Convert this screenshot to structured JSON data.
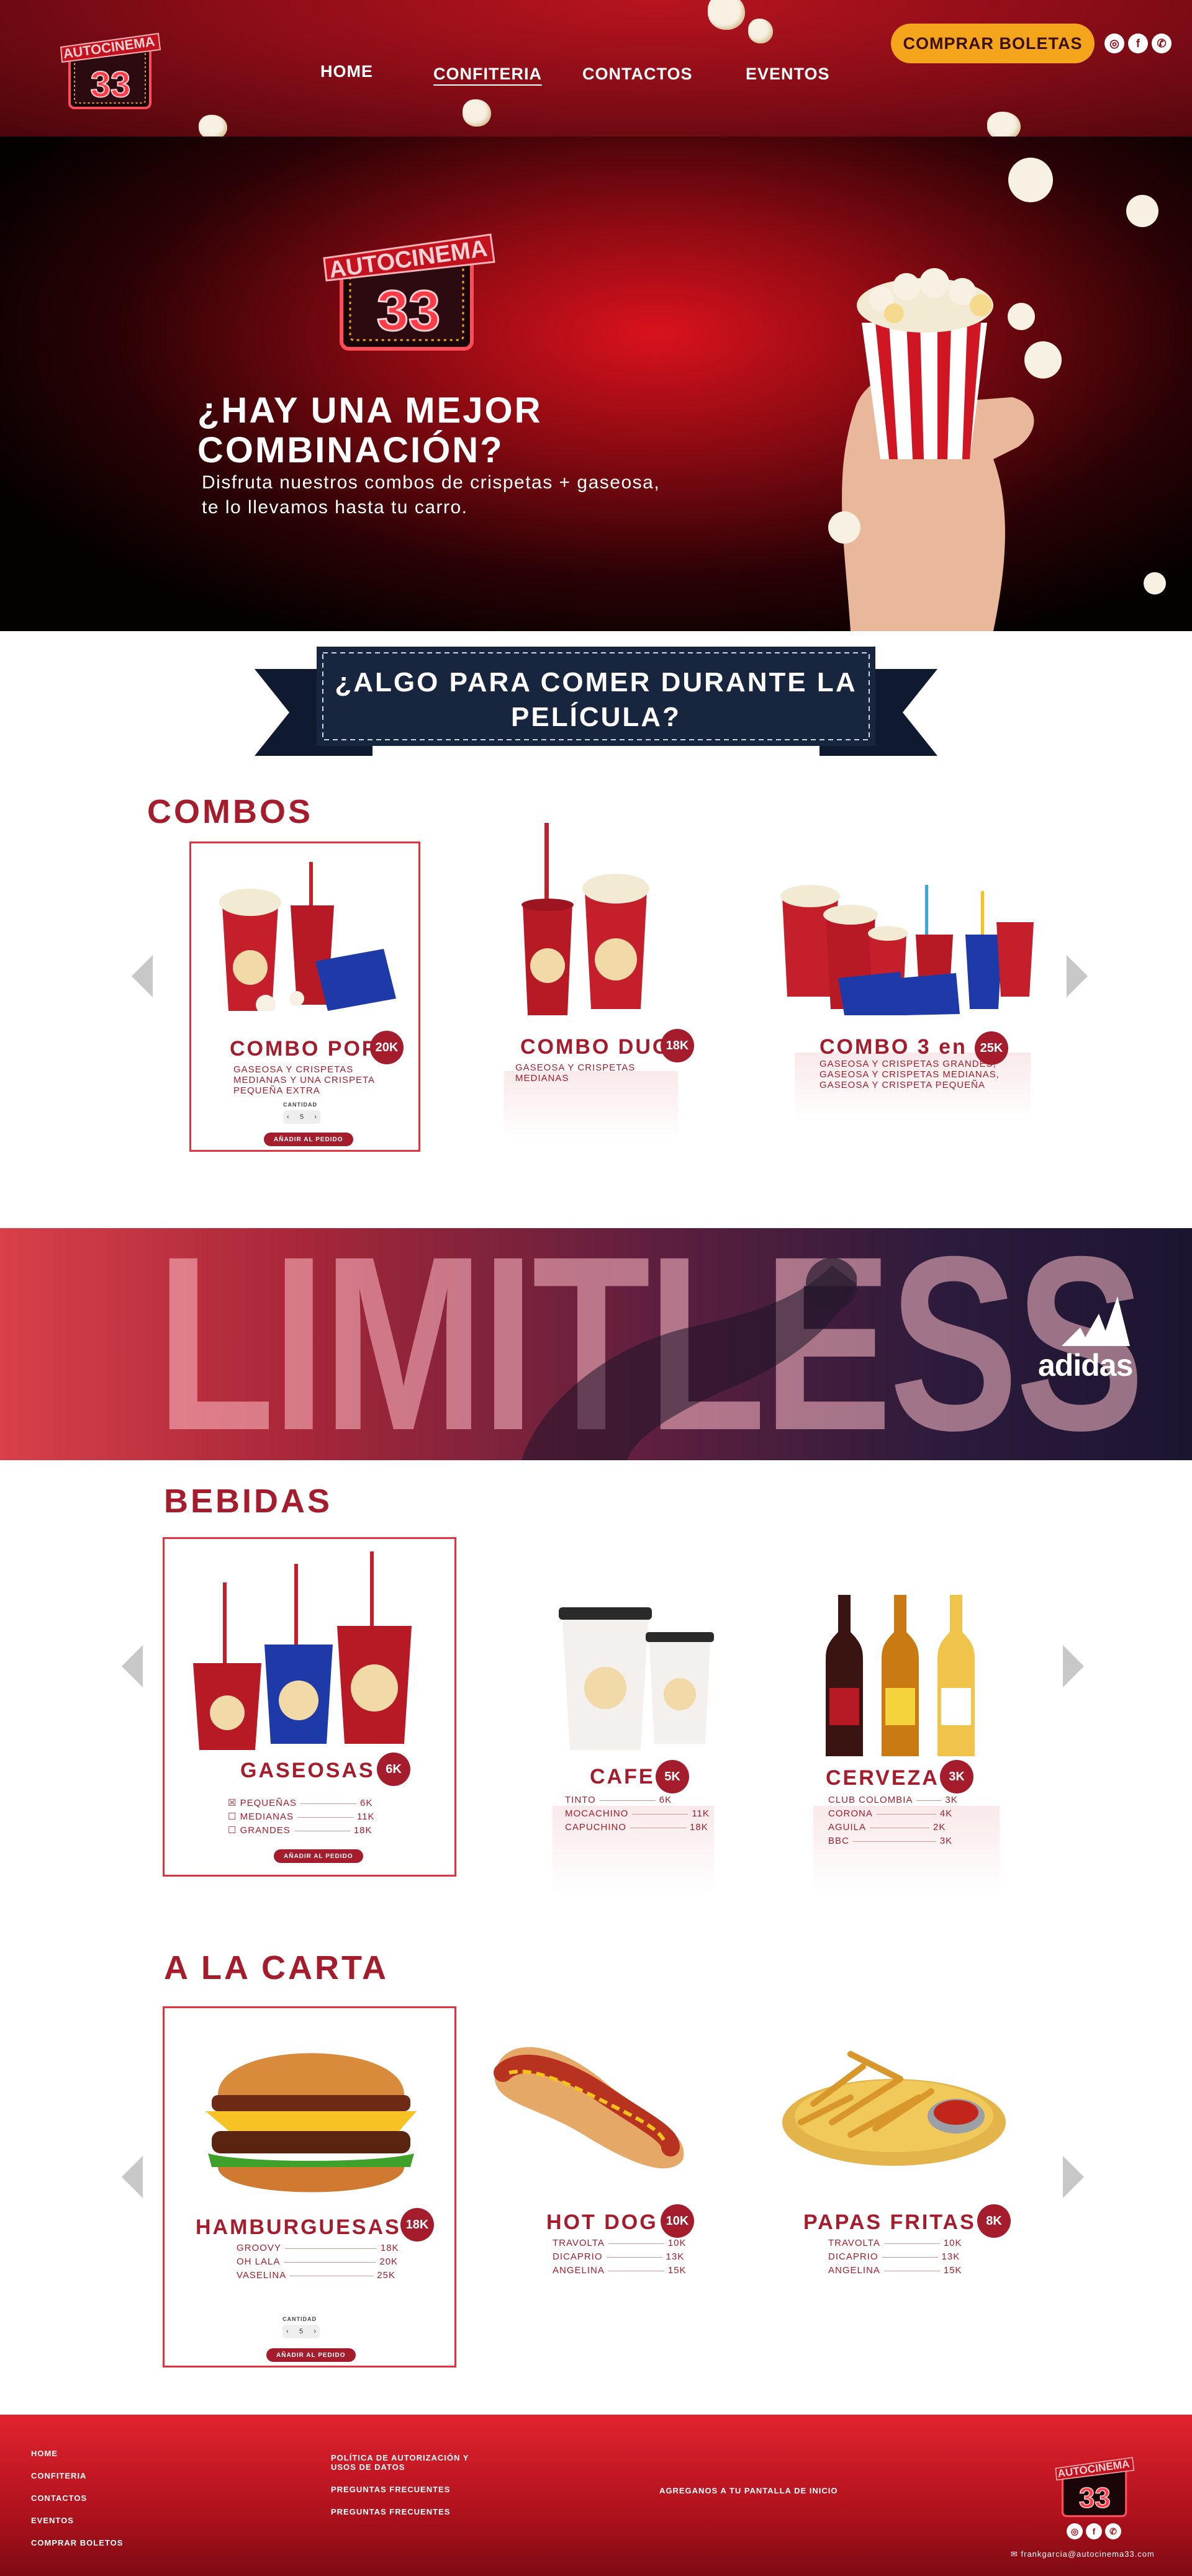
{
  "header": {
    "nav": [
      "HOME",
      "CONFITERIA",
      "CONTACTOS",
      "EVENTOS"
    ],
    "buy_button": "COMPRAR BOLETAS",
    "social_icons": [
      "instagram-icon",
      "facebook-icon",
      "whatsapp-icon"
    ]
  },
  "hero": {
    "title": "¿HAY UNA MEJOR COMBINACIÓN?",
    "subtitle": "Disfruta nuestros combos de crispetas + gaseosa, te lo llevamos hasta tu carro."
  },
  "banner": {
    "title": "¿ALGO PARA COMER DURANTE LA PELÍCULA?"
  },
  "combos": {
    "title": "COMBOS",
    "items": [
      {
        "name": "COMBO POP",
        "price": "20K",
        "desc": "GASEOSA Y CRISPETAS MEDIANAS Y UNA CRISPETA PEQUEÑA EXTRA"
      },
      {
        "name": "COMBO DUO",
        "price": "18K",
        "desc": "GASEOSA Y CRISPETAS MEDIANAS"
      },
      {
        "name": "COMBO 3 en 1",
        "price": "25K",
        "desc": "GASEOSA Y CRISPETAS GRANDES, GASEOSA Y CRISPETAS MEDIANAS, GASEOSA Y CRISPETA PEQUEÑA"
      }
    ],
    "qty_label": "CANTIDAD",
    "qty_value": "5",
    "add_label": "AÑADIR AL PEDIDO"
  },
  "ad": {
    "word": "LIMITLESS",
    "brand": "adidas"
  },
  "bebidas": {
    "title": "BEBIDAS",
    "items": [
      {
        "name": "GASEOSAS",
        "price": "6K",
        "options": [
          {
            "label": "PEQUEÑAS",
            "price": "6K"
          },
          {
            "label": "MEDIANAS",
            "price": "11K"
          },
          {
            "label": "GRANDES",
            "price": "18K"
          }
        ]
      },
      {
        "name": "CAFE",
        "price": "5K",
        "options": [
          {
            "label": "TINTO",
            "price": "6K"
          },
          {
            "label": "MOCACHINO",
            "price": "11K"
          },
          {
            "label": "CAPUCHINO",
            "price": "18K"
          }
        ]
      },
      {
        "name": "CERVEZA",
        "price": "3K",
        "options": [
          {
            "label": "CLUB COLOMBIA",
            "price": "3K"
          },
          {
            "label": "CORONA",
            "price": "4K"
          },
          {
            "label": "AGUILA",
            "price": "2K"
          },
          {
            "label": "BBC",
            "price": "3K"
          }
        ]
      }
    ],
    "add_label": "AÑADIR AL PEDIDO"
  },
  "carta": {
    "title": "A LA CARTA",
    "items": [
      {
        "name": "HAMBURGUESAS",
        "price": "18K",
        "options": [
          {
            "label": "GROOVY",
            "price": "18K"
          },
          {
            "label": "OH LALA",
            "price": "20K"
          },
          {
            "label": "VASELINA",
            "price": "25K"
          }
        ]
      },
      {
        "name": "HOT DOG",
        "price": "10K",
        "options": [
          {
            "label": "TRAVOLTA",
            "price": "10K"
          },
          {
            "label": "DICAPRIO",
            "price": "13K"
          },
          {
            "label": "ANGELINA",
            "price": "15K"
          }
        ]
      },
      {
        "name": "PAPAS FRITAS",
        "price": "8K",
        "options": [
          {
            "label": "TRAVOLTA",
            "price": "10K"
          },
          {
            "label": "DICAPRIO",
            "price": "13K"
          },
          {
            "label": "ANGELINA",
            "price": "15K"
          }
        ]
      }
    ],
    "qty_label": "CANTIDAD",
    "qty_value": "5",
    "add_label": "AÑADIR AL PEDIDO"
  },
  "footer": {
    "links": [
      "HOME",
      "CONFITERIA",
      "CONTACTOS",
      "EVENTOS",
      "COMPRAR BOLETOS"
    ],
    "legal": [
      "POLÍTICA DE AUTORIZACIÓN Y USOS DE DATOS",
      "PREGUNTAS FRECUENTES",
      "PREGUNTAS FRECUENTES"
    ],
    "home_screen": "AGREGANOS A TU PANTALLA DE INICIO",
    "email": "frankgarcia@autocinema33.com"
  },
  "logo": {
    "top": "AUTOCINEMA",
    "number": "33"
  },
  "colors": {
    "brand_red": "#a51d2c",
    "accent_orange": "#f5a51c",
    "navy": "#17253f"
  }
}
